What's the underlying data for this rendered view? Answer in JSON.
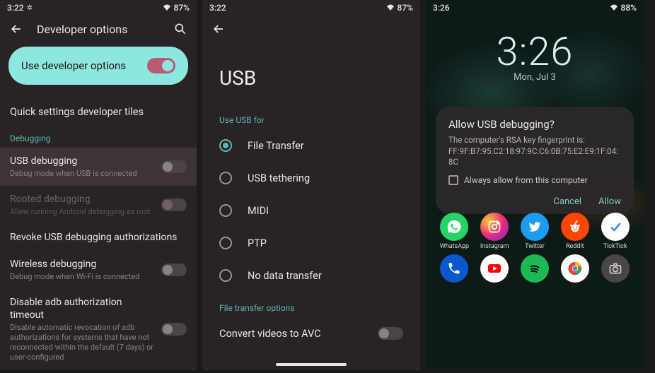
{
  "phone1": {
    "status": {
      "time": "3:22",
      "battery": "87%"
    },
    "header_title": "Developer options",
    "pill_label": "Use developer options",
    "quick_tiles": "Quick settings developer tiles",
    "debug_section": "Debugging",
    "rows": {
      "usb": {
        "title": "USB debugging",
        "sub": "Debug mode when USB is connected"
      },
      "rooted": {
        "title": "Rooted debugging",
        "sub": "Allow running Android debugging as root"
      },
      "revoke": {
        "title": "Revoke USB debugging authorizations"
      },
      "wireless": {
        "title": "Wireless debugging",
        "sub": "Debug mode when Wi-Fi is connected"
      },
      "adb": {
        "title": "Disable adb authorization timeout",
        "sub": "Disable automatic revocation of adb authorizations for systems that have not reconnected within the default (7 days) or user-configured"
      }
    }
  },
  "phone2": {
    "status": {
      "time": "3:22",
      "battery": "87%"
    },
    "title": "USB",
    "use_for": "Use USB for",
    "options": {
      "file": "File Transfer",
      "teth": "USB tethering",
      "midi": "MIDI",
      "ptp": "PTP",
      "none": "No data transfer"
    },
    "xfer_section": "File transfer options",
    "convert": "Convert videos to AVC"
  },
  "phone3": {
    "status": {
      "time": "3:26",
      "battery": "88%"
    },
    "clock": {
      "time": "3:26",
      "date": "Mon, Jul 3"
    },
    "dialog": {
      "title": "Allow USB debugging?",
      "body1": "The computer's RSA key fingerprint is:",
      "body2": "FF:9F:B7:95:C2:18:97:9C:C6:0B:75:E2:E9:1F:04:8C",
      "check": "Always allow from this computer",
      "cancel": "Cancel",
      "allow": "Allow"
    },
    "apps_row1": [
      {
        "name": "WhatsApp"
      },
      {
        "name": "Instagram"
      },
      {
        "name": "Twitter"
      },
      {
        "name": "Reddit"
      },
      {
        "name": "TickTick"
      }
    ],
    "apps_row2": [
      {
        "name": ""
      },
      {
        "name": ""
      },
      {
        "name": ""
      },
      {
        "name": ""
      },
      {
        "name": ""
      }
    ]
  }
}
